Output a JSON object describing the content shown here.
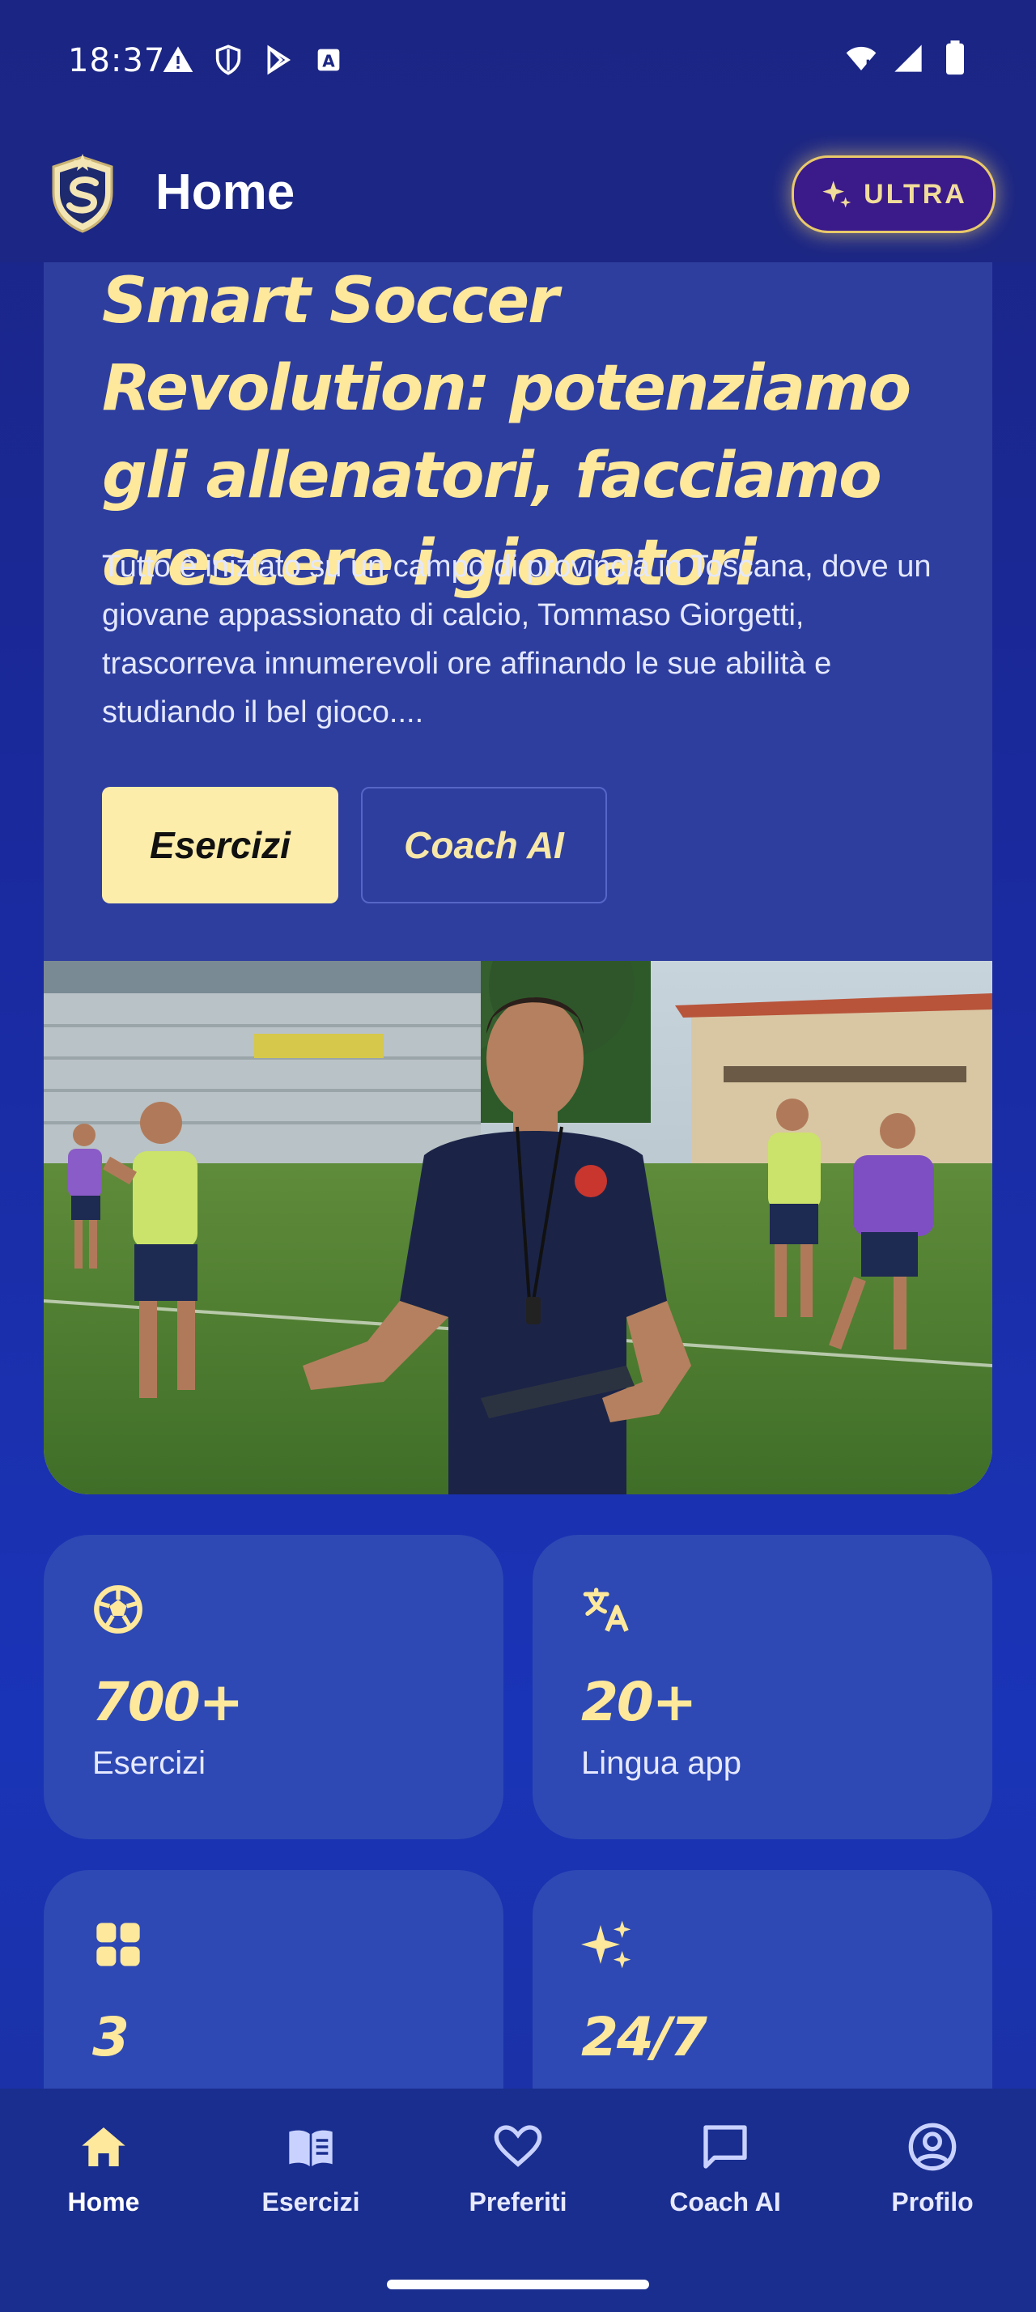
{
  "status_bar": {
    "time": "18:37",
    "left_icons": [
      "warning-icon",
      "shield-icon",
      "play-store-icon",
      "font-icon"
    ],
    "right_icons": [
      "wifi-icon",
      "signal-icon",
      "battery-icon"
    ]
  },
  "appbar": {
    "title": "Home",
    "ultra_label": "ULTRA"
  },
  "hero": {
    "title": "Smart Soccer Revolution: potenziamo gli allenatori, facciamo crescere i giocatori",
    "text": "Tutto è iniziato su un campo di provincia in Toscana, dove un giovane appassionato di calcio, Tommaso Giorgetti, trascorreva innumerevoli ore affinando le sue abilità e studiando il bel gioco....",
    "primary_button": "Esercizi",
    "secondary_button": "Coach AI"
  },
  "stats": [
    {
      "icon": "soccer-ball-icon",
      "value": "700+",
      "label": "Esercizi"
    },
    {
      "icon": "translate-icon",
      "value": "20+",
      "label": "Lingua app"
    },
    {
      "icon": "grid-icon",
      "value": "3",
      "label": ""
    },
    {
      "icon": "sparkle-icon",
      "value": "24/7",
      "label": ""
    }
  ],
  "bottom_nav": [
    {
      "label": "Home",
      "icon": "home-icon",
      "active": true
    },
    {
      "label": "Esercizi",
      "icon": "book-icon",
      "active": false
    },
    {
      "label": "Preferiti",
      "icon": "heart-icon",
      "active": false
    },
    {
      "label": "Coach AI",
      "icon": "chat-icon",
      "active": false
    },
    {
      "label": "Profilo",
      "icon": "profile-icon",
      "active": false
    }
  ],
  "colors": {
    "accent_yellow": "#fde89b",
    "background": "#1a2aa0",
    "card": "#2e49b4",
    "ultra_border": "#e9c96a"
  }
}
